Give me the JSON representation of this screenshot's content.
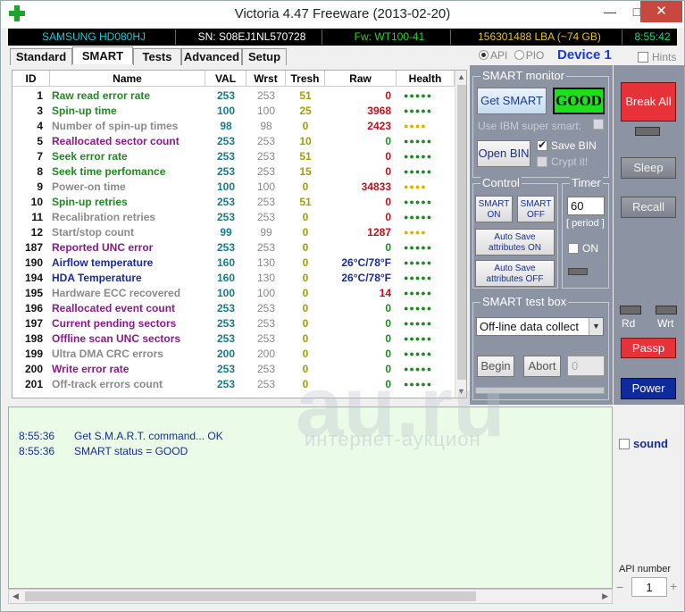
{
  "window": {
    "title": "Victoria 4.47  Freeware (2013-02-20)",
    "minimize": "—",
    "maximize": "□",
    "close": "✕"
  },
  "info_bar": {
    "model": "SAMSUNG HD080HJ",
    "serial": "SN: S08EJ1NL570728",
    "firmware": "Fw: WT100-41",
    "lba": "156301488 LBA (~74 GB)",
    "time": "8:55:42",
    "colors": {
      "model": "#1cc7d0",
      "serial": "#ffffff",
      "firmware": "#2cd22c",
      "lba": "#e6c02e",
      "time": "#1cd87a"
    }
  },
  "tabs": [
    {
      "label": "Standard",
      "active": false
    },
    {
      "label": "SMART",
      "active": true
    },
    {
      "label": "Tests",
      "active": false
    },
    {
      "label": "Advanced",
      "active": false
    },
    {
      "label": "Setup",
      "active": false
    }
  ],
  "mode": {
    "api": "API",
    "pio": "PIO",
    "selected": "API"
  },
  "device_label": "Device 1",
  "hints_label": "Hints",
  "table": {
    "columns": [
      "ID",
      "Name",
      "VAL",
      "Wrst",
      "Tresh",
      "Raw",
      "Health"
    ],
    "rows": [
      {
        "id": "1",
        "name": "Raw read error rate",
        "val": "253",
        "wrst": "253",
        "tresh": "51",
        "raw": "0",
        "health": "●●●●●",
        "name_color": "#1f8a1f",
        "raw_color": "#c0101a",
        "health_color": "#1f8a1f"
      },
      {
        "id": "3",
        "name": "Spin-up time",
        "val": "100",
        "wrst": "100",
        "tresh": "25",
        "raw": "3968",
        "health": "●●●●●",
        "name_color": "#1f8a1f",
        "raw_color": "#c0101a",
        "health_color": "#1f8a1f"
      },
      {
        "id": "4",
        "name": "Number of spin-up times",
        "val": "98",
        "wrst": "98",
        "tresh": "0",
        "raw": "2423",
        "health": "●●●●",
        "name_color": "#8a8a8a",
        "raw_color": "#c0101a",
        "health_color": "#e0b000"
      },
      {
        "id": "5",
        "name": "Reallocated sector count",
        "val": "253",
        "wrst": "253",
        "tresh": "10",
        "raw": "0",
        "health": "●●●●●",
        "name_color": "#8a1a8a",
        "raw_color": "#1f8a1f",
        "health_color": "#1f8a1f"
      },
      {
        "id": "7",
        "name": "Seek error rate",
        "val": "253",
        "wrst": "253",
        "tresh": "51",
        "raw": "0",
        "health": "●●●●●",
        "name_color": "#1f8a1f",
        "raw_color": "#c0101a",
        "health_color": "#1f8a1f"
      },
      {
        "id": "8",
        "name": "Seek time perfomance",
        "val": "253",
        "wrst": "253",
        "tresh": "15",
        "raw": "0",
        "health": "●●●●●",
        "name_color": "#1f8a1f",
        "raw_color": "#c0101a",
        "health_color": "#1f8a1f"
      },
      {
        "id": "9",
        "name": "Power-on time",
        "val": "100",
        "wrst": "100",
        "tresh": "0",
        "raw": "34833",
        "health": "●●●●",
        "name_color": "#8a8a8a",
        "raw_color": "#c0101a",
        "health_color": "#e0b000"
      },
      {
        "id": "10",
        "name": "Spin-up retries",
        "val": "253",
        "wrst": "253",
        "tresh": "51",
        "raw": "0",
        "health": "●●●●●",
        "name_color": "#1f8a1f",
        "raw_color": "#c0101a",
        "health_color": "#1f8a1f"
      },
      {
        "id": "11",
        "name": "Recalibration retries",
        "val": "253",
        "wrst": "253",
        "tresh": "0",
        "raw": "0",
        "health": "●●●●●",
        "name_color": "#8a8a8a",
        "raw_color": "#c0101a",
        "health_color": "#1f8a1f"
      },
      {
        "id": "12",
        "name": "Start/stop count",
        "val": "99",
        "wrst": "99",
        "tresh": "0",
        "raw": "1287",
        "health": "●●●●",
        "name_color": "#8a8a8a",
        "raw_color": "#c0101a",
        "health_color": "#e0b000"
      },
      {
        "id": "187",
        "name": "Reported UNC error",
        "val": "253",
        "wrst": "253",
        "tresh": "0",
        "raw": "0",
        "health": "●●●●●",
        "name_color": "#8a1a8a",
        "raw_color": "#1f8a1f",
        "health_color": "#1f8a1f"
      },
      {
        "id": "190",
        "name": "Airflow temperature",
        "val": "160",
        "wrst": "130",
        "tresh": "0",
        "raw": "26°C/78°F",
        "health": "●●●●●",
        "name_color": "#1a2a9a",
        "raw_color": "#1a2a9a",
        "health_color": "#1f8a1f"
      },
      {
        "id": "194",
        "name": "HDA Temperature",
        "val": "160",
        "wrst": "130",
        "tresh": "0",
        "raw": "26°C/78°F",
        "health": "●●●●●",
        "name_color": "#1a2a9a",
        "raw_color": "#1a2a9a",
        "health_color": "#1f8a1f"
      },
      {
        "id": "195",
        "name": "Hardware ECC recovered",
        "val": "100",
        "wrst": "100",
        "tresh": "0",
        "raw": "14",
        "health": "●●●●●",
        "name_color": "#8a8a8a",
        "raw_color": "#c0101a",
        "health_color": "#1f8a1f"
      },
      {
        "id": "196",
        "name": "Reallocated event count",
        "val": "253",
        "wrst": "253",
        "tresh": "0",
        "raw": "0",
        "health": "●●●●●",
        "name_color": "#8a1a8a",
        "raw_color": "#1f8a1f",
        "health_color": "#1f8a1f"
      },
      {
        "id": "197",
        "name": "Current pending sectors",
        "val": "253",
        "wrst": "253",
        "tresh": "0",
        "raw": "0",
        "health": "●●●●●",
        "name_color": "#8a1a8a",
        "raw_color": "#1f8a1f",
        "health_color": "#1f8a1f"
      },
      {
        "id": "198",
        "name": "Offline scan UNC sectors",
        "val": "253",
        "wrst": "253",
        "tresh": "0",
        "raw": "0",
        "health": "●●●●●",
        "name_color": "#8a1a8a",
        "raw_color": "#1f8a1f",
        "health_color": "#1f8a1f"
      },
      {
        "id": "199",
        "name": "Ultra DMA CRC errors",
        "val": "200",
        "wrst": "200",
        "tresh": "0",
        "raw": "0",
        "health": "●●●●●",
        "name_color": "#8a8a8a",
        "raw_color": "#1f8a1f",
        "health_color": "#1f8a1f"
      },
      {
        "id": "200",
        "name": "Write error rate",
        "val": "253",
        "wrst": "253",
        "tresh": "0",
        "raw": "0",
        "health": "●●●●●",
        "name_color": "#8a1a8a",
        "raw_color": "#1f8a1f",
        "health_color": "#1f8a1f"
      },
      {
        "id": "201",
        "name": "Off-track errors count",
        "val": "253",
        "wrst": "253",
        "tresh": "0",
        "raw": "0",
        "health": "●●●●●",
        "name_color": "#8a8a8a",
        "raw_color": "#1f8a1f",
        "health_color": "#1f8a1f"
      }
    ]
  },
  "smart_monitor": {
    "title": "SMART monitor",
    "get_smart": "Get SMART",
    "status": "GOOD",
    "ibm_label": "Use IBM super smart:",
    "open_bin": "Open BIN",
    "save_bin": "Save BIN",
    "save_bin_checked": true,
    "crypt": "Crypt it!"
  },
  "control": {
    "title": "Control",
    "smart_on": "SMART ON",
    "smart_off": "SMART OFF",
    "auto_on": "Auto Save attributes ON",
    "auto_off": "Auto Save attributes OFF"
  },
  "timer": {
    "title": "Timer",
    "value": "60",
    "period": "[ period ]",
    "on_label": "ON"
  },
  "smart_test": {
    "title": "SMART test box",
    "selected": "Off-line data collect",
    "begin": "Begin",
    "abort": "Abort",
    "value": "0"
  },
  "right_column": {
    "break_all": "Break All",
    "sleep": "Sleep",
    "recall": "Recall",
    "rd": "Rd",
    "wrt": "Wrt",
    "passp": "Passp",
    "power": "Power",
    "sound": "sound",
    "api_number_label": "API number",
    "api_number": "1",
    "minus": "−",
    "plus": "+"
  },
  "log": [
    {
      "time": "8:55:36",
      "text": "Get S.M.A.R.T. command... OK"
    },
    {
      "time": "8:55:36",
      "text": "SMART status = GOOD"
    }
  ],
  "watermark": {
    "main": "au.ru",
    "sub": "интернет-аукцион"
  }
}
